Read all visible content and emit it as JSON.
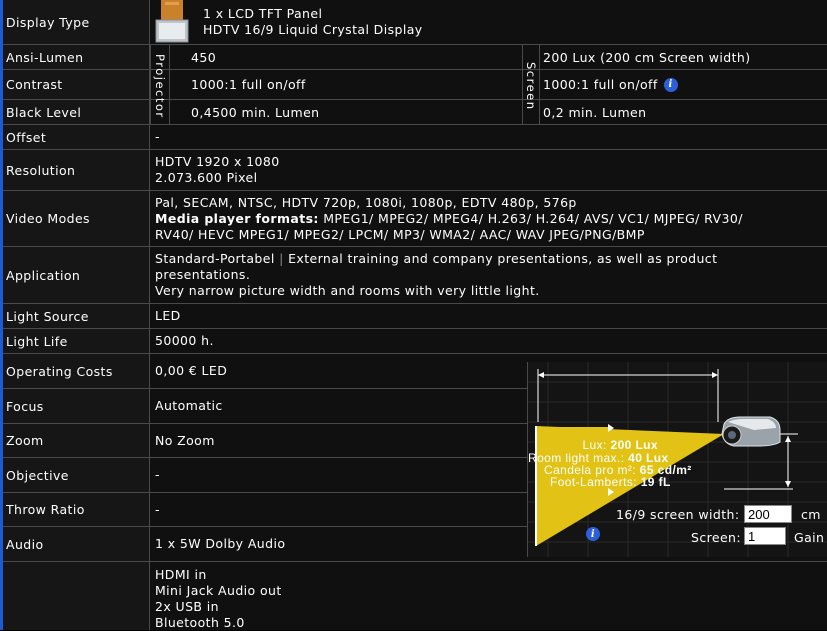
{
  "rows": {
    "display_type": {
      "label": "Display Type",
      "line1": "1 x LCD TFT Panel",
      "line2": "HDTV 16/9 Liquid Crystal Display"
    },
    "group_labels": {
      "projector": "Projector",
      "screen": "Screen"
    },
    "ansi_lumen": {
      "label": "Ansi-Lumen",
      "projector": "450",
      "screen": "200 Lux (200 cm Screen width)"
    },
    "contrast": {
      "label": "Contrast",
      "projector": "1000:1 full on/off",
      "screen": "1000:1 full on/off"
    },
    "black_level": {
      "label": "Black Level",
      "projector": "0,4500 min. Lumen",
      "screen": "0,2 min. Lumen"
    },
    "offset": {
      "label": "Offset",
      "value": "-"
    },
    "resolution": {
      "label": "Resolution",
      "line1": "HDTV 1920 x 1080",
      "line2": "2.073.600 Pixel"
    },
    "video_modes": {
      "label": "Video Modes",
      "line1": "Pal, SECAM, NTSC, HDTV 720p, 1080i, 1080p, EDTV 480p, 576p",
      "media_label": "Media player formats:",
      "media_text": " MPEG1/ MPEG2/ MPEG4/ H.263/ H.264/ AVS/ VC1/ MJPEG/ RV30/",
      "line3": "RV40/ HEVC MPEG1/ MPEG2/ LPCM/ MP3/ WMA2/ AAC/ WAV JPEG/PNG/BMP"
    },
    "application": {
      "label": "Application",
      "category": "Standard-Portabel",
      "separator": "|",
      "text": "External training and company presentations, as well as product",
      "line2": "presentations.",
      "line3": "Very narrow picture width and rooms with very little light."
    },
    "light_source": {
      "label": "Light Source",
      "value": "LED"
    },
    "light_life": {
      "label": "Light Life",
      "value": "50000 h."
    },
    "operating_costs": {
      "label": "Operating Costs",
      "value": "0,00 € LED"
    },
    "focus": {
      "label": "Focus",
      "value": "Automatic"
    },
    "zoom": {
      "label": "Zoom",
      "value": "No Zoom"
    },
    "objective": {
      "label": "Objective",
      "value": "-"
    },
    "throw_ratio": {
      "label": "Throw Ratio",
      "value": "-"
    },
    "audio": {
      "label": "Audio",
      "value": "1 x 5W Dolby Audio"
    },
    "connections": {
      "line1": "HDMI in",
      "line2": "Mini Jack Audio out",
      "line3": "2x USB in",
      "line4": "Bluetooth 5.0"
    }
  },
  "calculator": {
    "lux_label": "Lux:",
    "lux_value": "200 Lux",
    "room_light_label": "Room light max.:",
    "room_light_value": "40 Lux",
    "candela_label": "Candela pro m²:",
    "candela_value": "65 cd/m²",
    "foot_lamberts_label": "Foot-Lamberts:",
    "foot_lamberts_value": "19 fL",
    "screen_width_label": "16/9 screen width:",
    "screen_width_value": "200",
    "screen_width_unit": "cm",
    "screen_label": "Screen:",
    "gain_value": "1",
    "gain_label": "Gain"
  },
  "colors": {
    "beam": "#e2c214",
    "info": "#2d5fd8",
    "accent": "#1e5ad6"
  }
}
